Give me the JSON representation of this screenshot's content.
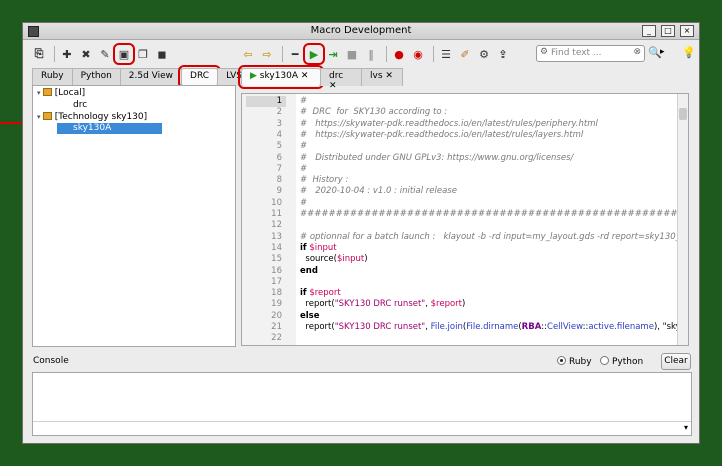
{
  "window": {
    "title": "Macro Development"
  },
  "window_controls": [
    "_",
    "□",
    "×"
  ],
  "toolbar": {
    "run_highlighted": true
  },
  "search": {
    "placeholder": "Find text ..."
  },
  "left_tabs": [
    "Ruby",
    "Python",
    "2.5d View",
    "DRC",
    "LVS"
  ],
  "left_active_tab": "DRC",
  "tree": [
    {
      "label": "[Local]",
      "level": 0,
      "type": "folder"
    },
    {
      "label": "drc",
      "level": 1,
      "type": "file"
    },
    {
      "label": "[Technology sky130]",
      "level": 0,
      "type": "folder"
    },
    {
      "label": "sky130A",
      "level": 1,
      "type": "file",
      "selected": true
    }
  ],
  "editor_tabs": [
    {
      "label": "sky130A",
      "close": "✕",
      "running": true
    },
    {
      "label": "drc",
      "close": "✕"
    },
    {
      "label": "lvs",
      "close": "✕"
    }
  ],
  "code_lines": [
    {
      "n": "1",
      "t": "#"
    },
    {
      "n": "2",
      "t": "#  DRC  for  SKY130 according to :"
    },
    {
      "n": "3",
      "t": "#   https://skywater-pdk.readthedocs.io/en/latest/rules/periphery.html"
    },
    {
      "n": "4",
      "t": "#   https://skywater-pdk.readthedocs.io/en/latest/rules/layers.html"
    },
    {
      "n": "5",
      "t": "#"
    },
    {
      "n": "6",
      "t": "#   Distributed under GNU GPLv3: https://www.gnu.org/licenses/"
    },
    {
      "n": "7",
      "t": "#"
    },
    {
      "n": "8",
      "t": "#  History :"
    },
    {
      "n": "9",
      "t": "#   2020-10-04 : v1.0 : initial release"
    },
    {
      "n": "10",
      "t": "#"
    },
    {
      "n": "11",
      "t": "##########################################################################"
    },
    {
      "n": "12",
      "t": ""
    },
    {
      "n": "13",
      "t": "# optionnal for a batch launch :   klayout -b -rd input=my_layout.gds -rd report=sky130_drc.txt"
    },
    {
      "n": "14",
      "t": "if $input"
    },
    {
      "n": "15",
      "t": "  source($input)"
    },
    {
      "n": "16",
      "t": "end"
    },
    {
      "n": "17",
      "t": ""
    },
    {
      "n": "18",
      "t": "if $report"
    },
    {
      "n": "19",
      "t": "  report(\"SKY130 DRC runset\", $report)"
    },
    {
      "n": "20",
      "t": "else"
    },
    {
      "n": "21",
      "t": "  report(\"SKY130 DRC runset\", File.join(File.dirname(RBA::CellView::active.filename), \"sky130_d"
    },
    {
      "n": "22",
      "t": ""
    }
  ],
  "console": {
    "label": "Console",
    "ruby": "Ruby",
    "python": "Python",
    "clear": "Clear",
    "selected": "Ruby"
  },
  "colors": {
    "highlight": "#d40000",
    "selection": "#3b8ad8",
    "background": "#1e5a1e"
  }
}
